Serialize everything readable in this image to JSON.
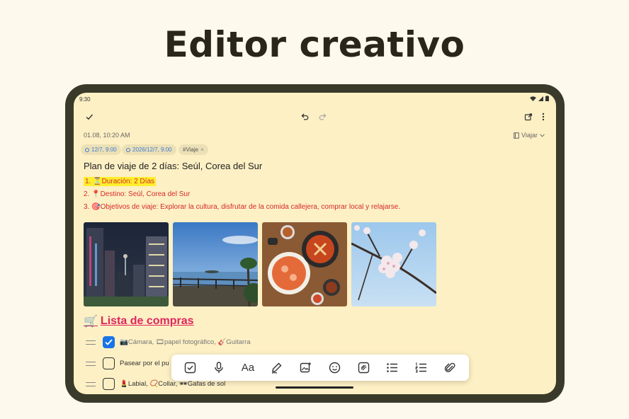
{
  "headline": "Editor creativo",
  "status": {
    "time": "9:30"
  },
  "note": {
    "date": "01.08, 10:20 AM",
    "folder": "Viajar",
    "tags": [
      {
        "label": "12/7, 9:00"
      },
      {
        "label": "2026/12/7, 9:00"
      },
      {
        "label": "#Viaje",
        "close": "×"
      }
    ],
    "title": "Plan de viaje de 2 días: Seúl, Corea del Sur",
    "list": [
      {
        "num": "1.",
        "text": "⏳Duración: 2 Días"
      },
      {
        "num": "2.",
        "text": "📍Destino: Seúl, Corea del Sur"
      },
      {
        "num": "3.",
        "text": "🎯Objetivos de viaje: Explorar la cultura, disfrutar de la comida callejera, comprar local y relajarse."
      }
    ],
    "section_icon": "🛒",
    "section_title": "Lista de compras",
    "checklist": [
      {
        "text": "📷Cámara, 🎞papel fotográfico, 🎸Guitarra",
        "checked": true
      },
      {
        "text": "Pasear por el pu",
        "checked": false
      },
      {
        "text": "💄Labial, 📿Collar, 🕶Gafas de sol",
        "checked": false
      }
    ]
  },
  "format_bar": {
    "text_size_label": "Aa"
  },
  "colors": {
    "accent": "#1a73e8",
    "heading": "#e0245e",
    "list_text": "#d42a2a",
    "highlight": "#ffee2e",
    "note_bg": "#fdf0c4"
  }
}
